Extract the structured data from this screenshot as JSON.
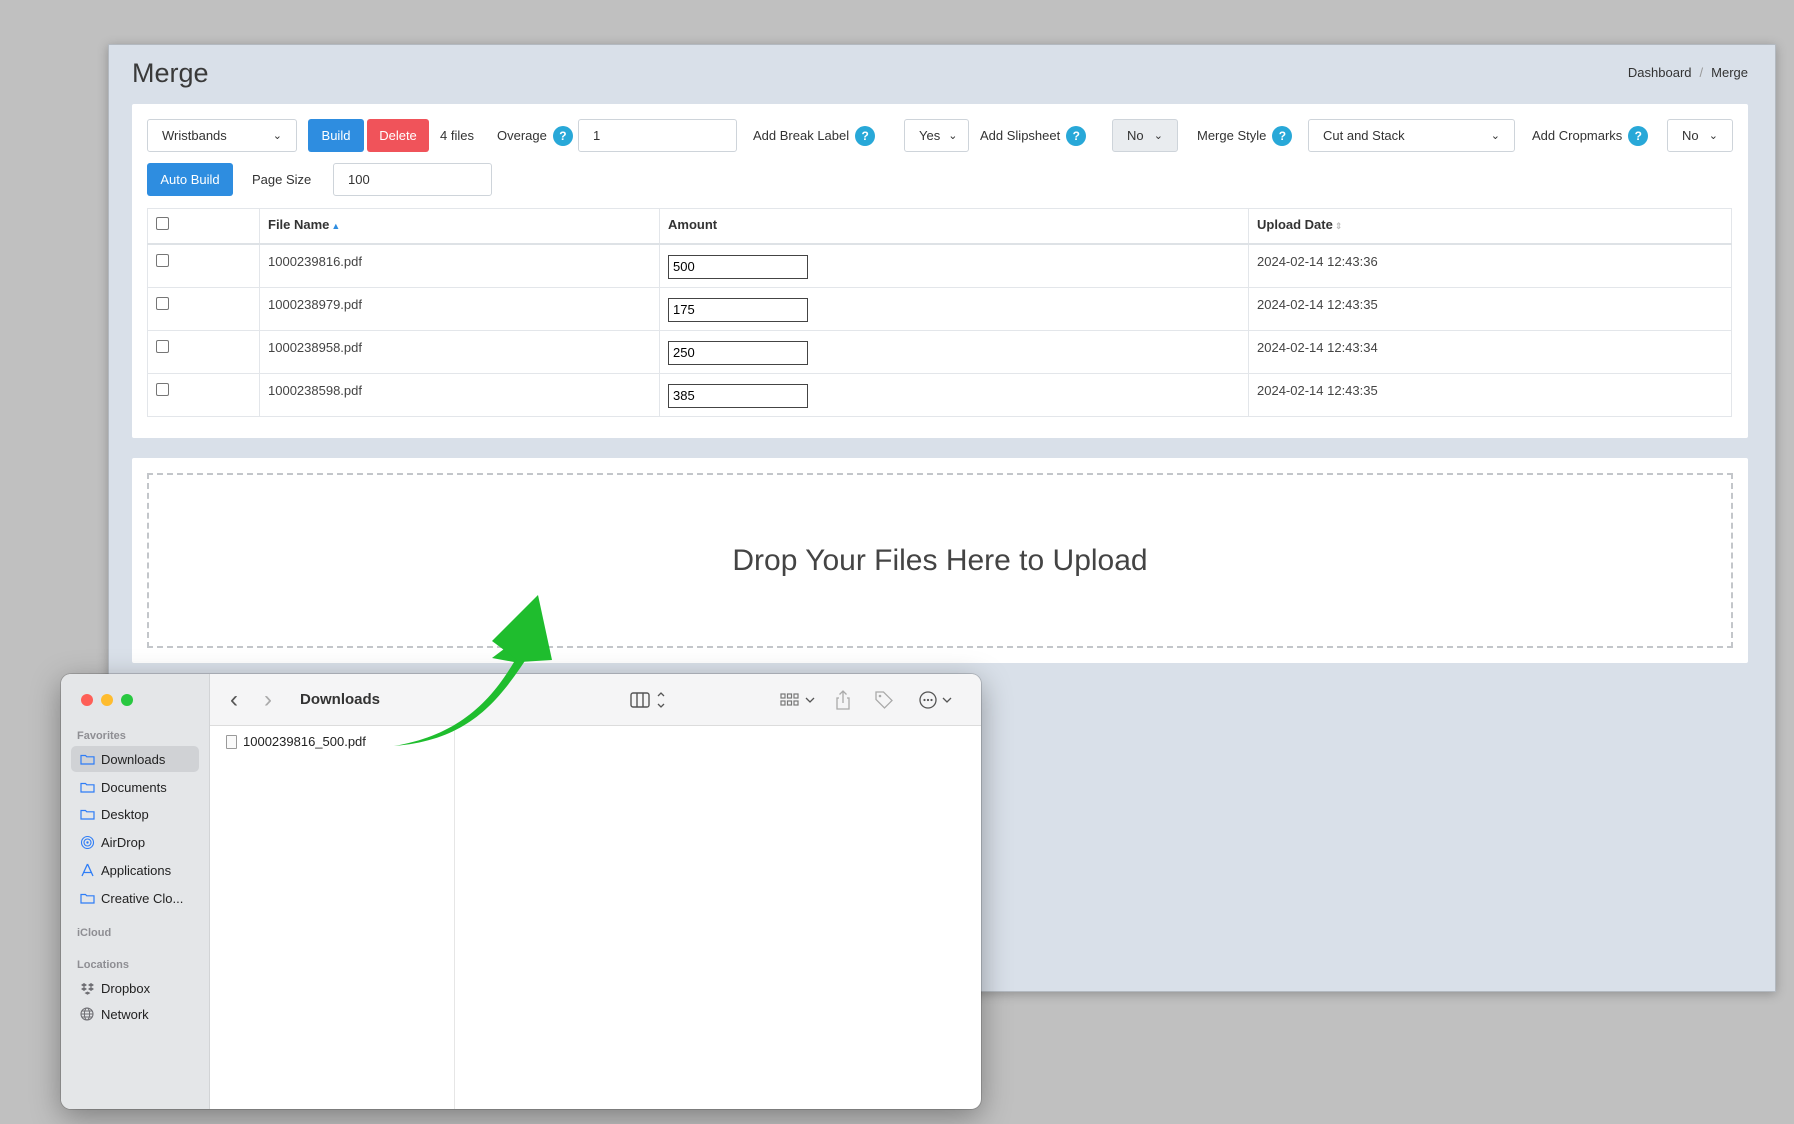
{
  "app": {
    "title": "Merge",
    "breadcrumb": {
      "home": "Dashboard",
      "separator": "/",
      "current": "Merge"
    },
    "toolbar": {
      "template_select": "Wristbands",
      "build_label": "Build",
      "delete_label": "Delete",
      "file_count": "4 files",
      "overage_label": "Overage",
      "overage_value": "1",
      "break_label_label": "Add Break Label",
      "break_label_value": "Yes",
      "slipsheet_label": "Add Slipsheet",
      "slipsheet_value": "No",
      "merge_style_label": "Merge Style",
      "merge_style_value": "Cut and Stack",
      "cropmarks_label": "Add Cropmarks",
      "cropmarks_value": "No",
      "auto_build_label": "Auto Build",
      "page_size_label": "Page Size",
      "page_size_value": "100",
      "help_glyph": "?"
    },
    "table": {
      "columns": [
        "File Name",
        "Amount",
        "Upload Date"
      ],
      "rows": [
        {
          "file": "1000239816.pdf",
          "amount": "500",
          "date": "2024-02-14 12:43:36"
        },
        {
          "file": "1000238979.pdf",
          "amount": "175",
          "date": "2024-02-14 12:43:35"
        },
        {
          "file": "1000238958.pdf",
          "amount": "250",
          "date": "2024-02-14 12:43:34"
        },
        {
          "file": "1000238598.pdf",
          "amount": "385",
          "date": "2024-02-14 12:43:35"
        }
      ]
    },
    "dropzone_text": "Drop Your Files Here to Upload"
  },
  "finder": {
    "title": "Downloads",
    "sidebar": {
      "favorites_header": "Favorites",
      "favorites": [
        "Downloads",
        "Documents",
        "Desktop",
        "AirDrop",
        "Applications",
        "Creative Clo..."
      ],
      "icloud_header": "iCloud",
      "locations_header": "Locations",
      "locations": [
        "Dropbox",
        "Network"
      ]
    },
    "file": "1000239816_500.pdf"
  },
  "colors": {
    "primary": "#2e8de0",
    "danger": "#f0535a",
    "help": "#28a8d8",
    "arrow": "#1fbd2e"
  },
  "icons": {
    "select_chevron": "⌄",
    "sort_asc": "▲",
    "sort_both": "⇕",
    "back": "‹",
    "forward": "›"
  }
}
